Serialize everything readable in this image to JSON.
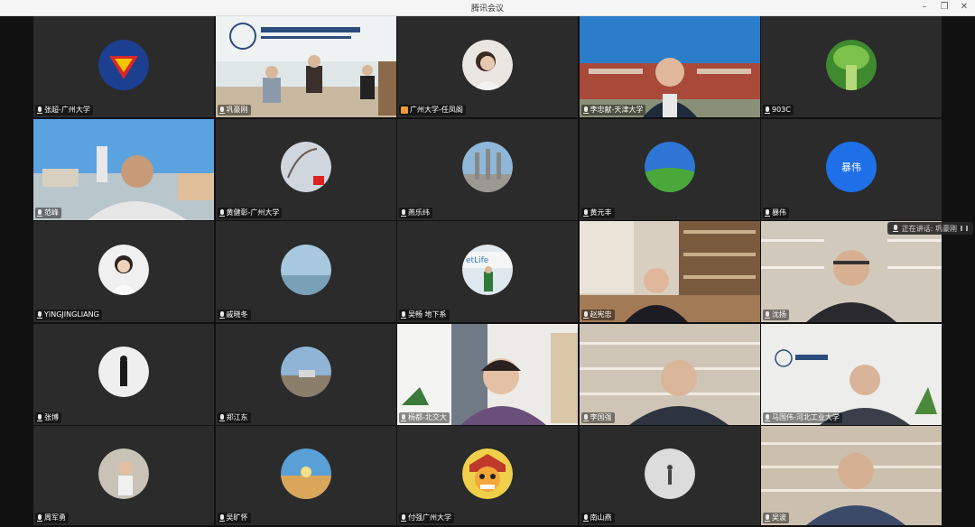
{
  "window": {
    "title": "腾讯会议"
  },
  "speaking": {
    "label": "正在讲话: 巩豪刚"
  },
  "tiles": [
    {
      "name": "张超-广州大学"
    },
    {
      "name": "巩豪刚"
    },
    {
      "name": "广州大学-任凤阁"
    },
    {
      "name": "李忠献-天津大学"
    },
    {
      "name": "903C"
    },
    {
      "name": "范峰"
    },
    {
      "name": "黄健彰-广州大学"
    },
    {
      "name": "燕乐纬"
    },
    {
      "name": "黄元丰"
    },
    {
      "name": "暴伟",
      "avatar_text": "暴伟"
    },
    {
      "name": "YINGJINGLIANG"
    },
    {
      "name": "戚晓冬"
    },
    {
      "name": "吴畅  地下系"
    },
    {
      "name": "赵宪忠"
    },
    {
      "name": "沈扬"
    },
    {
      "name": "张博"
    },
    {
      "name": "郑江东"
    },
    {
      "name": "杨都-北交大"
    },
    {
      "name": "李国强"
    },
    {
      "name": "马国伟-河北工业大学"
    },
    {
      "name": "周军勇"
    },
    {
      "name": "吴旷怀"
    },
    {
      "name": "付强广州大学"
    },
    {
      "name": "南山燕"
    },
    {
      "name": "吴波"
    }
  ],
  "colors": {
    "accent": "#1e6fe8",
    "tile_bg": "#2b2b2b",
    "orange": "#f29b38"
  }
}
